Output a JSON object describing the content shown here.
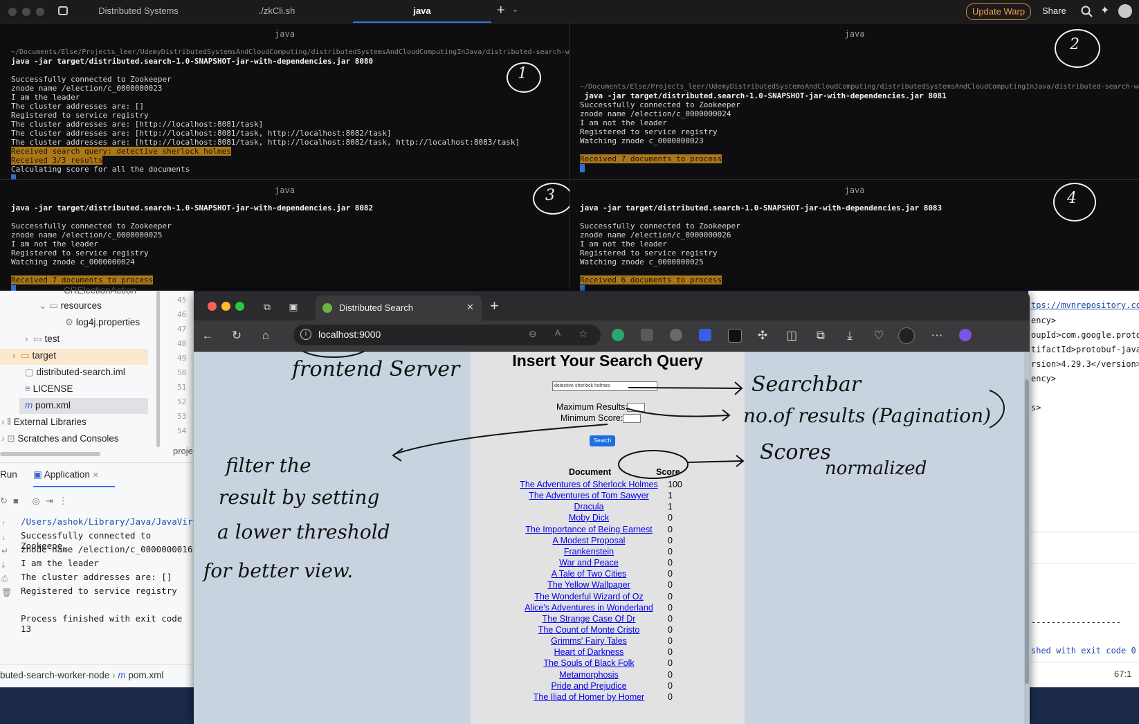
{
  "warp": {
    "tabs": [
      "Distributed Systems",
      "./zkCli.sh",
      "java"
    ],
    "update_label": "Update Warp",
    "share_label": "Share",
    "panes": [
      {
        "title": "java",
        "annotation": "1",
        "path": "~/Documents/Else/Projects_leer/UdemyDistributedSystemsAndCloudComputing/distributedSystemsAndCloudComputingInJava/distributed-search-wor",
        "command": "java -jar target/distributed.search-1.0-SNAPSHOT-jar-with-dependencies.jar 8080",
        "lines": [
          "Successfully connected to Zookeeper",
          "znode name /election/c_0000000023",
          "I am the leader",
          "The cluster addresses are: []",
          "Registered to service registry",
          "The cluster addresses are: [http://localhost:8081/task]",
          "The cluster addresses are: [http://localhost:8081/task, http://localhost:8082/task]",
          "The cluster addresses are: [http://localhost:8081/task, http://localhost:8082/task, http://localhost:8083/task]"
        ],
        "highlights": [
          "Received search query: detective sherlock holmes",
          "Received 3/3 results"
        ],
        "last_line": "Calculating score for all the documents"
      },
      {
        "title": "java",
        "annotation": "2",
        "path": "~/Documents/Else/Projects_leer/UdemyDistributedSystemsAndCloudComputing/distributedSystemsAndCloudComputingInJava/distributed-search-wo",
        "command": "java -jar target/distributed.search-1.0-SNAPSHOT-jar-with-dependencies.jar 8081",
        "lines": [
          "Successfully connected to Zookeeper",
          "znode name /election/c_0000000024",
          "I am not the leader",
          "Registered to service registry",
          "Watching znode c_0000000023"
        ],
        "highlights": [
          "Received 7 documents to process"
        ]
      },
      {
        "title": "java",
        "annotation": "3",
        "command": "java -jar target/distributed.search-1.0-SNAPSHOT-jar-with-dependencies.jar 8082",
        "lines": [
          "Successfully connected to Zookeeper",
          "znode name /election/c_0000000025",
          "I am not the leader",
          "Registered to service registry",
          "Watching znode c_0000000024"
        ],
        "highlights": [
          "Received 7 documents to process"
        ]
      },
      {
        "title": "java",
        "annotation": "4",
        "command": "java -jar target/distributed.search-1.0-SNAPSHOT-jar-with-dependencies.jar 8083",
        "lines": [
          "Successfully connected to Zookeeper",
          "znode name /election/c_0000000026",
          "I am not the leader",
          "Registered to service registry",
          "Watching znode c_0000000025"
        ],
        "highlights": [
          "Received 6 documents to process"
        ]
      }
    ]
  },
  "ide": {
    "tree": [
      "resources",
      "log4j.properties",
      "test",
      "target",
      "distributed-search.iml",
      "LICENSE",
      "pom.xml",
      "External Libraries",
      "Scratches and Consoles"
    ],
    "partial_top": "CRElectionAction",
    "gutter": [
      "45",
      "46",
      "47",
      "48",
      "49",
      "50",
      "51",
      "52",
      "53",
      "54"
    ],
    "project_tab": "proje",
    "run_label": "Run",
    "run_tab": "Application",
    "console": [
      "/Users/ashok/Library/Java/JavaVirt",
      "Successfully connected to Zookeepe",
      "znode name /election/c_0000000016",
      "I am the leader",
      "The cluster addresses are: []",
      "Registered to service registry",
      "",
      "Process finished with exit code 13"
    ],
    "breadcrumb_module": "buted-search-worker-node",
    "breadcrumb_file": "pom.xml",
    "right_lines": [
      "tps://mvnrepository.co",
      "ency>",
      "oupId>com.google.protob",
      "tifactId>protobuf-java<",
      "rsion>4.29.3</version>",
      "ency>",
      "s>",
      "------------------",
      "shed with exit code 0"
    ],
    "status_position": "67:1"
  },
  "browser": {
    "tab_title": "Distributed Search",
    "url": "localhost:9000",
    "page": {
      "title": "Insert Your Search Query",
      "query_value": "detective sherlock holmes",
      "max_results_label": "Maximum Results:",
      "min_score_label": "Minimum Score:",
      "search_label": "Search",
      "col_document": "Document",
      "col_score": "Score",
      "results": [
        {
          "doc": "The Adventures of Sherlock Holmes",
          "score": "100"
        },
        {
          "doc": "The Adventures of Tom Sawyer",
          "score": "1"
        },
        {
          "doc": "Dracula",
          "score": "1"
        },
        {
          "doc": "Moby Dick",
          "score": "0"
        },
        {
          "doc": "The Importance of Being Earnest",
          "score": "0"
        },
        {
          "doc": "A Modest Proposal",
          "score": "0"
        },
        {
          "doc": "Frankenstein",
          "score": "0"
        },
        {
          "doc": "War and Peace",
          "score": "0"
        },
        {
          "doc": "A Tale of Two Cities",
          "score": "0"
        },
        {
          "doc": "The Yellow Wallpaper",
          "score": "0"
        },
        {
          "doc": "The Wonderful Wizard of Oz",
          "score": "0"
        },
        {
          "doc": "Alice's Adventures in Wonderland",
          "score": "0"
        },
        {
          "doc": "The Strange Case Of Dr",
          "score": "0"
        },
        {
          "doc": "The Count of Monte Cristo",
          "score": "0"
        },
        {
          "doc": "Grimms' Fairy Tales",
          "score": "0"
        },
        {
          "doc": "Heart of Darkness",
          "score": "0"
        },
        {
          "doc": "The Souls of Black Folk",
          "score": "0"
        },
        {
          "doc": "Metamorphosis",
          "score": "0"
        },
        {
          "doc": "Pride and Prejudice",
          "score": "0"
        },
        {
          "doc": "The Iliad of Homer by Homer",
          "score": "0"
        }
      ]
    }
  },
  "annotations": {
    "frontend": "frontend Server",
    "searchbar": "Searchbar",
    "pagination": "no.of results (Pagination)",
    "scores": "Scores",
    "normalized": "normalized",
    "filter": [
      "filter the",
      "result by setting",
      "a lower threshold",
      "for better view."
    ]
  }
}
